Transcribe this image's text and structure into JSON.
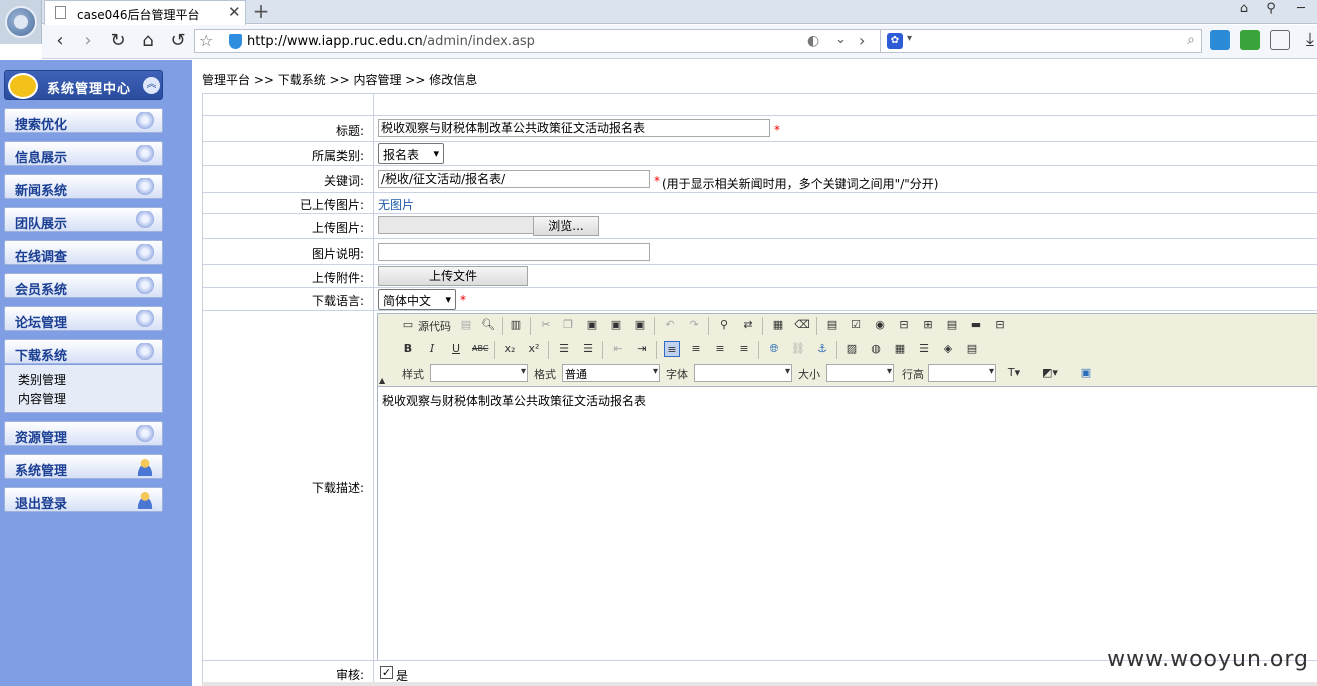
{
  "browser": {
    "tab_title": "case046后台管理平台",
    "new_tab_symbol": "+",
    "url_host": "http://www.iapp.ruc.edu.cn",
    "url_path": "/admin/index.asp",
    "search_placeholder": ""
  },
  "sidebar": {
    "header_title": "系统管理中心",
    "items": [
      {
        "label": "搜索优化",
        "icon": "gem-icon"
      },
      {
        "label": "信息展示",
        "icon": "gem-icon"
      },
      {
        "label": "新闻系统",
        "icon": "gem-icon"
      },
      {
        "label": "团队展示",
        "icon": "gem-icon"
      },
      {
        "label": "在线调查",
        "icon": "gem-icon"
      },
      {
        "label": "会员系统",
        "icon": "gem-icon"
      },
      {
        "label": "论坛管理",
        "icon": "gem-icon"
      },
      {
        "label": "下载系统",
        "icon": "gem-icon"
      },
      {
        "label": "资源管理",
        "icon": "gem-icon"
      },
      {
        "label": "系统管理",
        "icon": "user-icon"
      },
      {
        "label": "退出登录",
        "icon": "user-icon"
      }
    ],
    "submenu": [
      "类别管理",
      "内容管理"
    ]
  },
  "main": {
    "breadcrumb": "管理平台 >> 下载系统 >> 内容管理 >> 修改信息",
    "fields": {
      "title_label": "标题:",
      "title_value": "税收观察与财税体制改革公共政策征文活动报名表",
      "category_label": "所属类别:",
      "category_value": "报名表",
      "keywords_label": "关键词:",
      "keywords_value": "/税收/征文活动/报名表/",
      "keywords_hint": "(用于显示相关新闻时用，多个关键词之间用\"/\"分开)",
      "uploaded_image_label": "已上传图片:",
      "uploaded_image_value": "无图片",
      "upload_image_label": "上传图片:",
      "browse_button": "浏览...",
      "image_desc_label": "图片说明:",
      "image_desc_value": "",
      "attachment_label": "上传附件:",
      "upload_file_button": "上传文件",
      "language_label": "下载语言:",
      "language_value": "简体中文",
      "description_label": "下载描述:",
      "review_label": "审核:",
      "review_option": "是",
      "required_mark": "*"
    },
    "editor": {
      "source_label": "源代码",
      "style_label": "样式",
      "format_label": "格式",
      "format_value": "普通",
      "font_label": "字体",
      "size_label": "大小",
      "line_height_label": "行高",
      "content": "税收观察与财税体制改革公共政策征文活动报名表"
    }
  },
  "watermark": "www.wooyun.org"
}
